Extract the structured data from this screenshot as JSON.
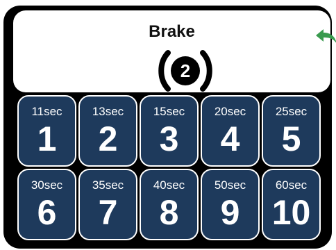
{
  "header": {
    "title": "Brake",
    "brake_icon_number": "2",
    "back_icon": "back-arrow-icon"
  },
  "colors": {
    "tile_background": "#1e3a5c",
    "back_arrow": "#3a9b4f",
    "frame": "#000000"
  },
  "options": [
    {
      "duration": "11sec",
      "number": "1"
    },
    {
      "duration": "13sec",
      "number": "2"
    },
    {
      "duration": "15sec",
      "number": "3"
    },
    {
      "duration": "20sec",
      "number": "4"
    },
    {
      "duration": "25sec",
      "number": "5"
    },
    {
      "duration": "30sec",
      "number": "6"
    },
    {
      "duration": "35sec",
      "number": "7"
    },
    {
      "duration": "40sec",
      "number": "8"
    },
    {
      "duration": "50sec",
      "number": "9"
    },
    {
      "duration": "60sec",
      "number": "10"
    }
  ]
}
